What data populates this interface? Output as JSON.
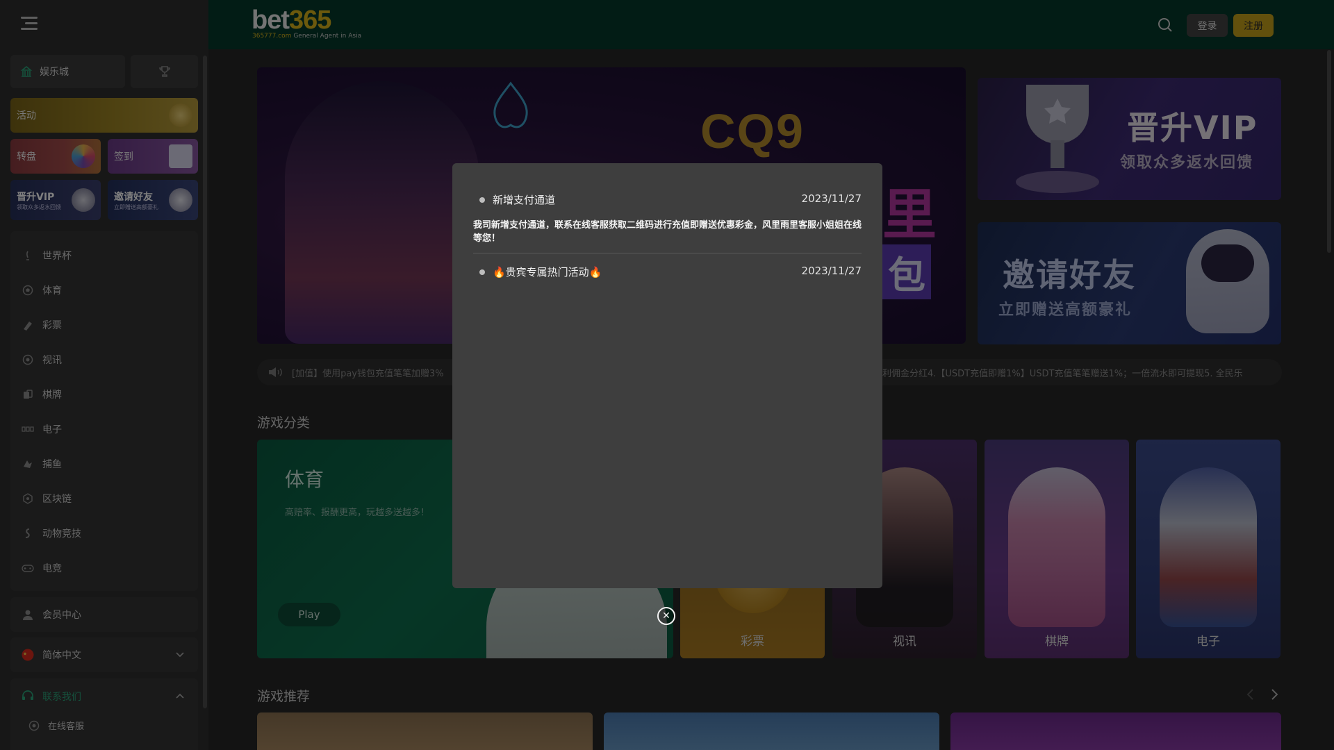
{
  "header": {
    "brand_part1": "bet",
    "brand_part2": "365",
    "tagline_url": "365777.com",
    "tagline_text": "General Agent in Asia",
    "login_label": "登录",
    "register_label": "注册"
  },
  "sidebar": {
    "tab_casino": "娱乐城",
    "promos": {
      "activity": "活动",
      "wheel": "转盘",
      "signin": "签到",
      "vip_title": "晋升VIP",
      "vip_sub": "领取众多返水回馈",
      "invite_title": "邀请好友",
      "invite_sub": "立即赠送高额豪礼"
    },
    "menu": [
      {
        "label": "世界杯",
        "icon": "cup-icon"
      },
      {
        "label": "体育",
        "icon": "soccer-ball-icon"
      },
      {
        "label": "彩票",
        "icon": "lottery-icon"
      },
      {
        "label": "视讯",
        "icon": "live-casino-icon"
      },
      {
        "label": "棋牌",
        "icon": "cards-icon"
      },
      {
        "label": "电子",
        "icon": "slot-machine-icon"
      },
      {
        "label": "捕鱼",
        "icon": "fish-icon"
      },
      {
        "label": "区块链",
        "icon": "blockchain-icon"
      },
      {
        "label": "动物竞技",
        "icon": "animal-race-icon"
      },
      {
        "label": "电竞",
        "icon": "gamepad-icon"
      }
    ],
    "member_center": "会员中心",
    "language": "简体中文",
    "contact_us": "联系我们",
    "online_service": "在线客服"
  },
  "main": {
    "banner_brand": "CQ9",
    "banner_text1": "里",
    "banner_text2": "包",
    "vip_banner_title": "晋升VIP",
    "vip_banner_sub": "领取众多返水回馈",
    "invite_banner_title": "邀请好友",
    "invite_banner_sub": "立即赠送高额豪礼",
    "marquee_left": "[加值】使用pay钱包充值笔笔加赠3%",
    "marquee_right": "利佣金分红4.【USDT充值即赠1%】USDT充值笔笔赠送1%；一倍流水即可提现5. 全民乐",
    "section_categories": "游戏分类",
    "section_recommended": "游戏推荐",
    "sport_title": "体育",
    "sport_desc": "高赔率、报酬更高，玩越多送越多！",
    "play_label": "Play",
    "categories": [
      "彩票",
      "视讯",
      "棋牌",
      "电子"
    ]
  },
  "modal": {
    "notices": [
      {
        "title": "新增支付通道",
        "date": "2023/11/27",
        "body": "我司新增支付通道，联系在线客服获取二维码进行充值即赠送优惠彩金，风里雨里客服小姐姐在线等您！"
      },
      {
        "title": "🔥贵宾专属热门活动🔥",
        "date": "2023/11/27"
      }
    ],
    "close_symbol": "✕"
  },
  "colors": {
    "header_bg": "#05392a",
    "accent_gold": "#c4a11b",
    "accent_green": "#2aa57a",
    "page_bg": "#272727"
  }
}
